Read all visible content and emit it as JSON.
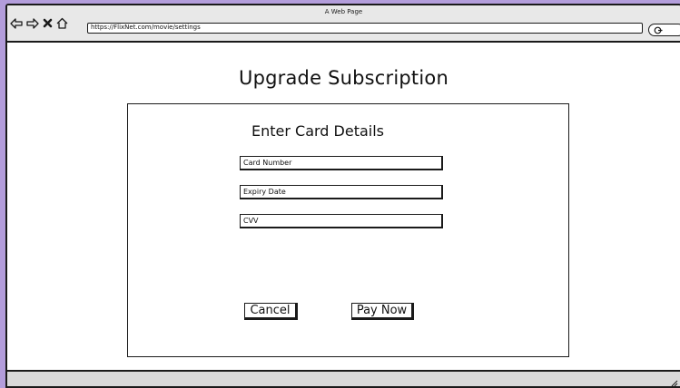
{
  "window": {
    "title": "A Web Page"
  },
  "browser": {
    "url": "https://FlixNet.com/movie/settings",
    "icons": [
      "back-arrow-icon",
      "forward-arrow-icon",
      "close-icon",
      "home-icon",
      "search-icon"
    ]
  },
  "page": {
    "title": "Upgrade Subscription"
  },
  "card_form": {
    "heading": "Enter Card Details",
    "fields": [
      {
        "name": "card-number",
        "value": "Card Number"
      },
      {
        "name": "expiry-date",
        "value": "Expiry Date"
      },
      {
        "name": "cvv",
        "value": "CVV"
      }
    ],
    "cancel_label": "Cancel",
    "pay_label": "Pay Now"
  },
  "colors": {
    "background": "#b39ddb",
    "window": "#ffffff",
    "stroke": "#1a1a1a"
  }
}
